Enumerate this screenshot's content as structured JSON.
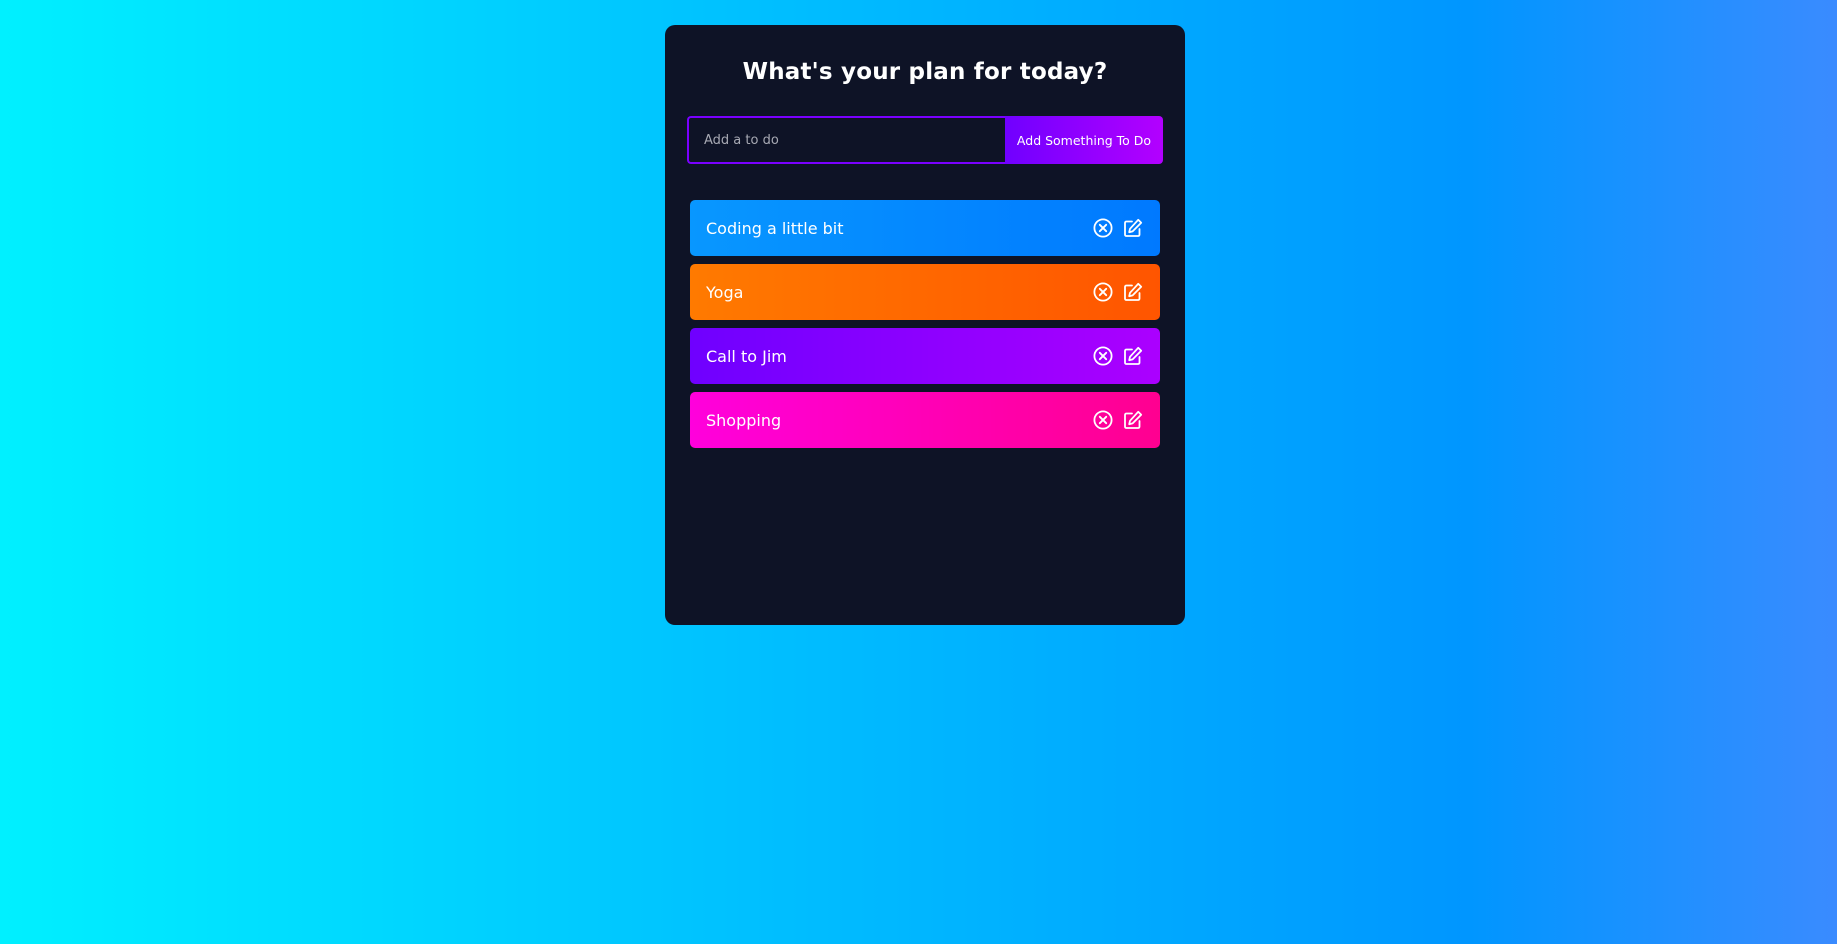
{
  "app": {
    "title": "What's your plan for today?"
  },
  "form": {
    "input_value": "",
    "input_placeholder": "Add a to do",
    "button_label": "Add Something To Do"
  },
  "todos": [
    {
      "text": "Coding a little bit",
      "color": "blue"
    },
    {
      "text": "Yoga",
      "color": "orange"
    },
    {
      "text": "Call to Jim",
      "color": "purple"
    },
    {
      "text": "Shopping",
      "color": "pink"
    }
  ],
  "icons": {
    "delete": "close-circle-icon",
    "edit": "edit-icon"
  },
  "colors": {
    "panel_bg": "#0e1326",
    "accent": "#7a00ff",
    "blue": "#0087ff",
    "orange": "#ff6a00",
    "purple": "#8a00ff",
    "pink": "#ff00b4"
  }
}
